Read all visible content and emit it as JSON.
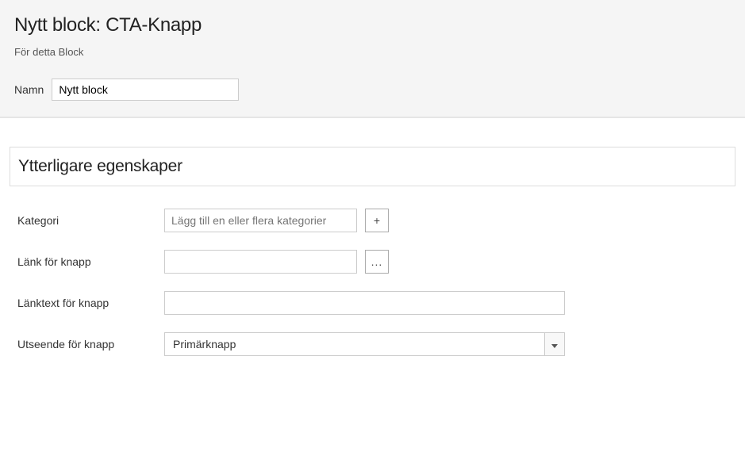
{
  "header": {
    "title": "Nytt block: CTA-Knapp",
    "subtitle": "För detta Block",
    "name_label": "Namn",
    "name_value": "Nytt block"
  },
  "section": {
    "title": "Ytterligare egenskaper"
  },
  "form": {
    "kategori": {
      "label": "Kategori",
      "placeholder": "Lägg till en eller flera kategorier",
      "add_symbol": "+"
    },
    "link": {
      "label": "Länk för knapp",
      "value": "",
      "browse_symbol": "..."
    },
    "linktext": {
      "label": "Länktext för knapp",
      "value": ""
    },
    "utseende": {
      "label": "Utseende för knapp",
      "selected": "Primärknapp"
    }
  }
}
